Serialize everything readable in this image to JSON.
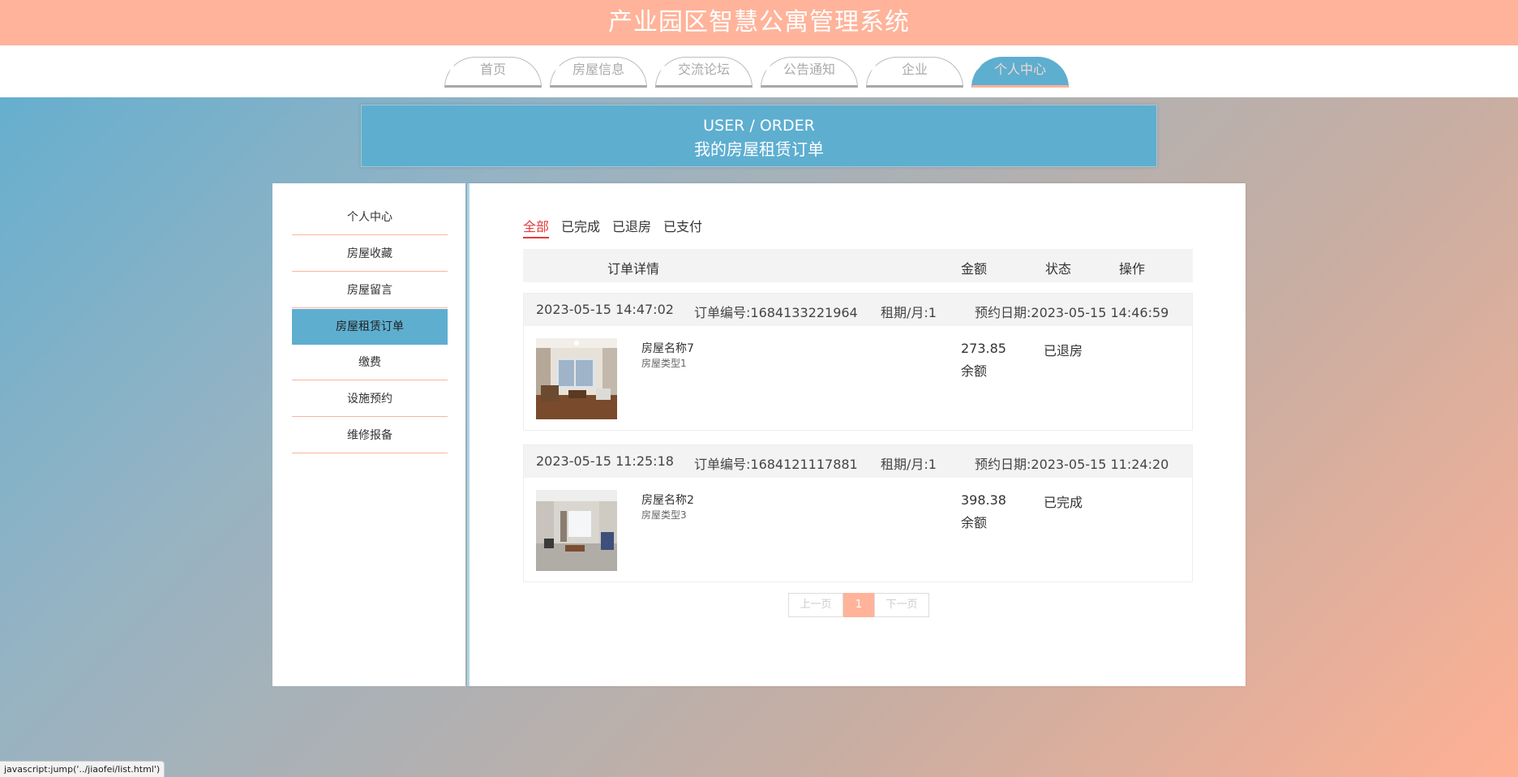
{
  "header": {
    "title": "产业园区智慧公寓管理系统"
  },
  "nav": {
    "tabs": [
      {
        "label": "首页"
      },
      {
        "label": "房屋信息"
      },
      {
        "label": "交流论坛"
      },
      {
        "label": "公告通知"
      },
      {
        "label": "企业"
      },
      {
        "label": "个人中心",
        "active": true
      }
    ]
  },
  "banner": {
    "en": "USER / ORDER",
    "cn": "我的房屋租赁订单"
  },
  "sidebar": {
    "items": [
      {
        "label": "个人中心"
      },
      {
        "label": "房屋收藏"
      },
      {
        "label": "房屋留言"
      },
      {
        "label": "房屋租赁订单",
        "active": true
      },
      {
        "label": "缴费"
      },
      {
        "label": "设施预约"
      },
      {
        "label": "维修报备"
      }
    ]
  },
  "filters": {
    "items": [
      {
        "label": "全部",
        "active": true
      },
      {
        "label": "已完成"
      },
      {
        "label": "已退房"
      },
      {
        "label": "已支付"
      }
    ]
  },
  "table": {
    "headers": {
      "detail": "订单详情",
      "amount": "金额",
      "status": "状态",
      "action": "操作"
    }
  },
  "orders": [
    {
      "time": "2023-05-15 14:47:02",
      "order_no": "订单编号:1684133221964",
      "term": "租期/月:1",
      "reserve": "预约日期:2023-05-15 14:46:59",
      "house_name": "房屋名称7",
      "house_type": "房屋类型1",
      "amount": "273.85",
      "pay_method": "余额",
      "status": "已退房"
    },
    {
      "time": "2023-05-15 11:25:18",
      "order_no": "订单编号:1684121117881",
      "term": "租期/月:1",
      "reserve": "预约日期:2023-05-15 11:24:20",
      "house_name": "房屋名称2",
      "house_type": "房屋类型3",
      "amount": "398.38",
      "pay_method": "余额",
      "status": "已完成"
    }
  ],
  "pager": {
    "prev": "上一页",
    "current": "1",
    "next": "下一页"
  },
  "statusbar": {
    "text": "javascript:jump('../jiaofei/list.html')"
  }
}
